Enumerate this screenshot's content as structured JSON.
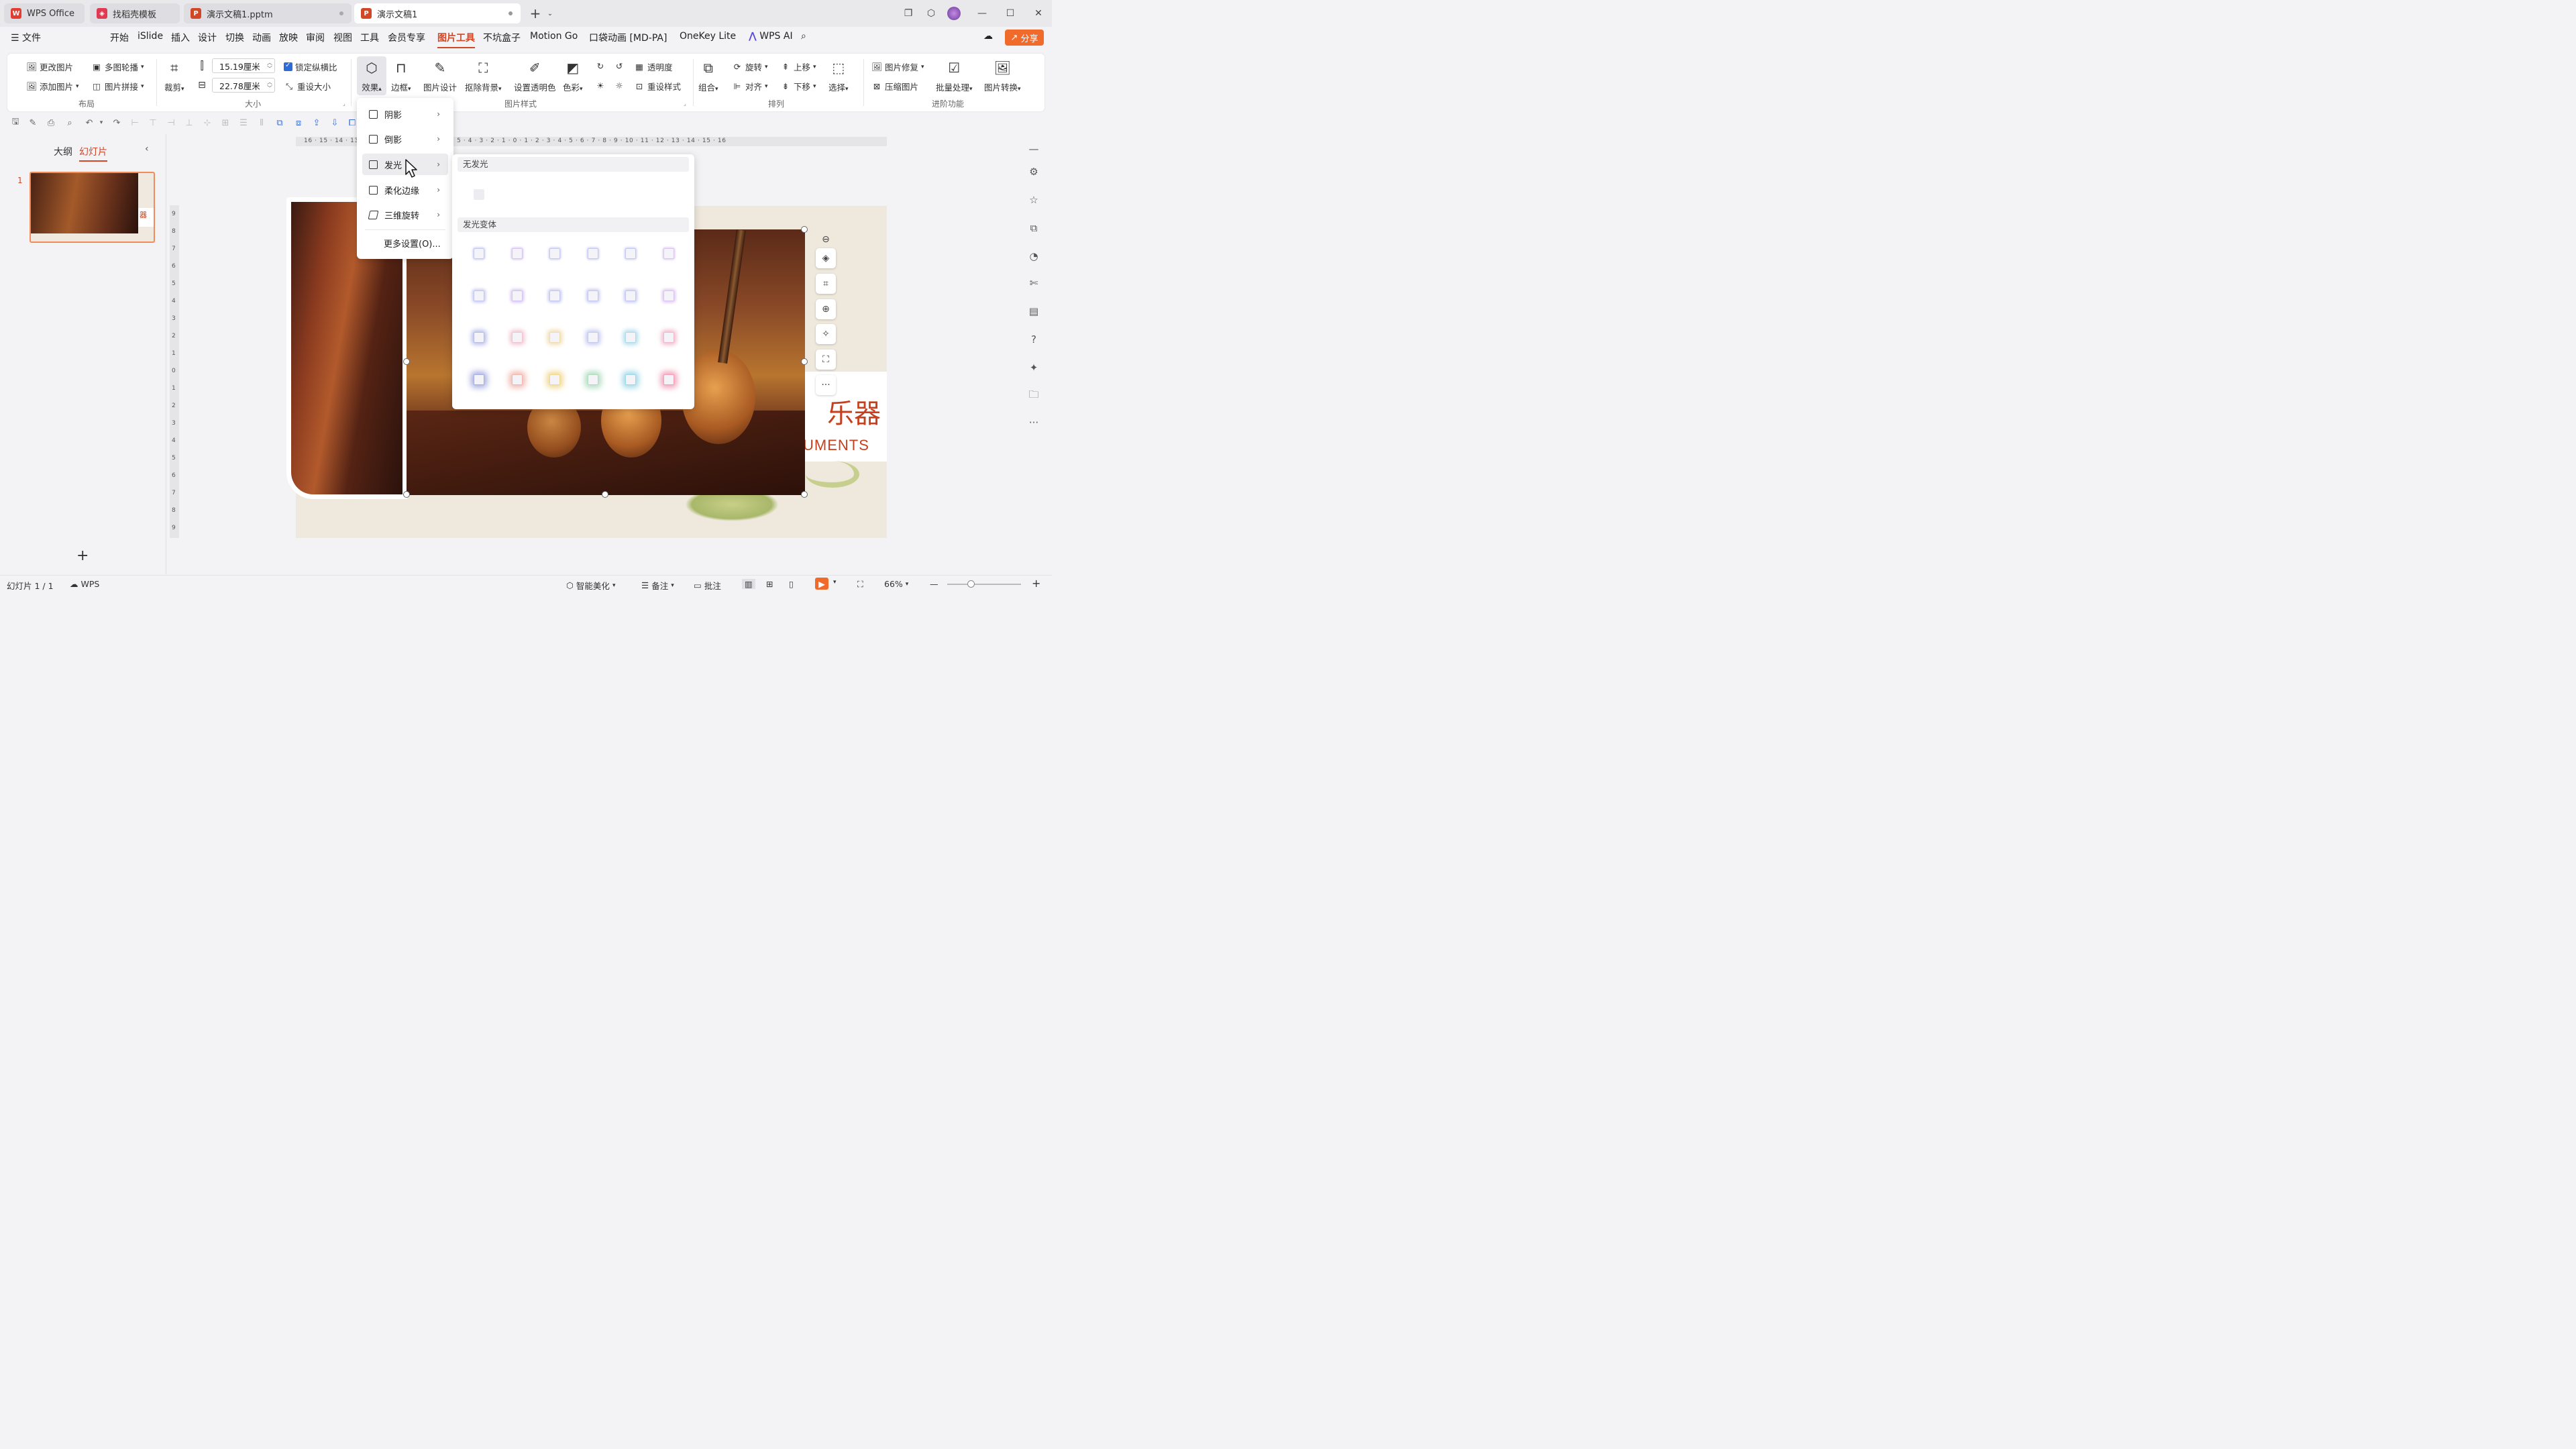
{
  "tabs": [
    {
      "label": "WPS Office",
      "logo": "W",
      "color": "#e33c30"
    },
    {
      "label": "找稻壳模板",
      "logo": "◈",
      "color": "#e03a52"
    },
    {
      "label": "演示文稿1.pptm",
      "logo": "P",
      "color": "#d24726"
    },
    {
      "label": "演示文稿1",
      "logo": "P",
      "color": "#d24726"
    }
  ],
  "menu": {
    "file": "文件",
    "items": [
      "开始",
      "iSlide",
      "插入",
      "设计",
      "切换",
      "动画",
      "放映",
      "审阅",
      "视图",
      "工具",
      "会员专享",
      "图片工具",
      "不坑盒子",
      "Motion Go",
      "口袋动画 [MD-PA]",
      "OneKey Lite",
      "WPS AI"
    ],
    "share": "分享"
  },
  "ribbon": {
    "change_pic": "更改图片",
    "add_pic": "添加图片",
    "multi_carousel": "多图轮播",
    "pic_collage": "图片拼接",
    "group_layout": "布局",
    "crop": "裁剪",
    "width": "15.19厘米",
    "height": "22.78厘米",
    "lock_ratio": "锁定纵横比",
    "reset_size": "重设大小",
    "group_size": "大小",
    "effects": "效果",
    "border": "边框",
    "pic_design": "图片设计",
    "remove_bg": "抠除背景",
    "set_transparent": "设置透明色",
    "color": "色彩",
    "transparency": "透明度",
    "reset_style": "重设样式",
    "group_style": "图片样式",
    "combine": "组合",
    "rotate": "旋转",
    "align": "对齐",
    "move_up": "上移",
    "move_down": "下移",
    "select": "选择",
    "group_arrange": "排列",
    "pic_repair": "图片修复",
    "compress": "压缩图片",
    "batch": "批量处理",
    "convert": "图片转换",
    "group_advanced": "进阶功能"
  },
  "left_panel": {
    "outline": "大纲",
    "slides": "幻灯片",
    "slide_number": "1"
  },
  "slide": {
    "title_fragment": "乐器",
    "subtitle_fragment": "UMENTS"
  },
  "effects_menu": {
    "items": [
      "阴影",
      "倒影",
      "发光",
      "柔化边缘",
      "三维旋转"
    ],
    "more": "更多设置(O)..."
  },
  "glow_panel": {
    "no_glow": "无发光",
    "variants": "发光变体"
  },
  "ruler_h": "16 · 15 · 14 · 13 · 12 · 11 · 10 · 9 · 8 · 7 · 6 · 5 · 4 · 3 · 2 · 1 · 0 · 1 · 2 · 3 · 4 · 5 · 6 · 7 · 8 · 9 · 10 · 11 · 12 · 13 · 14 · 15 · 16",
  "status": {
    "slide_info": "幻灯片 1 / 1",
    "wps": "WPS",
    "beautify": "智能美化",
    "notes": "备注",
    "comment": "批注",
    "zoom": "66%"
  },
  "colors": {
    "accent": "#d24726",
    "share": "#f06a2c",
    "glow_rows": [
      [
        "#c5c9f0",
        "#d6c5f0",
        "#c5c9f0",
        "#c5c9f0",
        "#c5c9f0",
        "#dcc5f0"
      ],
      [
        "#c5c9f0",
        "#d6c5f0",
        "#c5c9f0",
        "#c5c9f0",
        "#c5c9f0",
        "#dcc5f0"
      ],
      [
        "#b8bde8",
        "#f0c5d0",
        "#f0dcb0",
        "#c5c9f0",
        "#b0dcea",
        "#f0b8cc"
      ],
      [
        "#a8aee0",
        "#f0b8b0",
        "#f0d890",
        "#b0dcc0",
        "#a0d8e8",
        "#f0a0b8"
      ]
    ]
  }
}
